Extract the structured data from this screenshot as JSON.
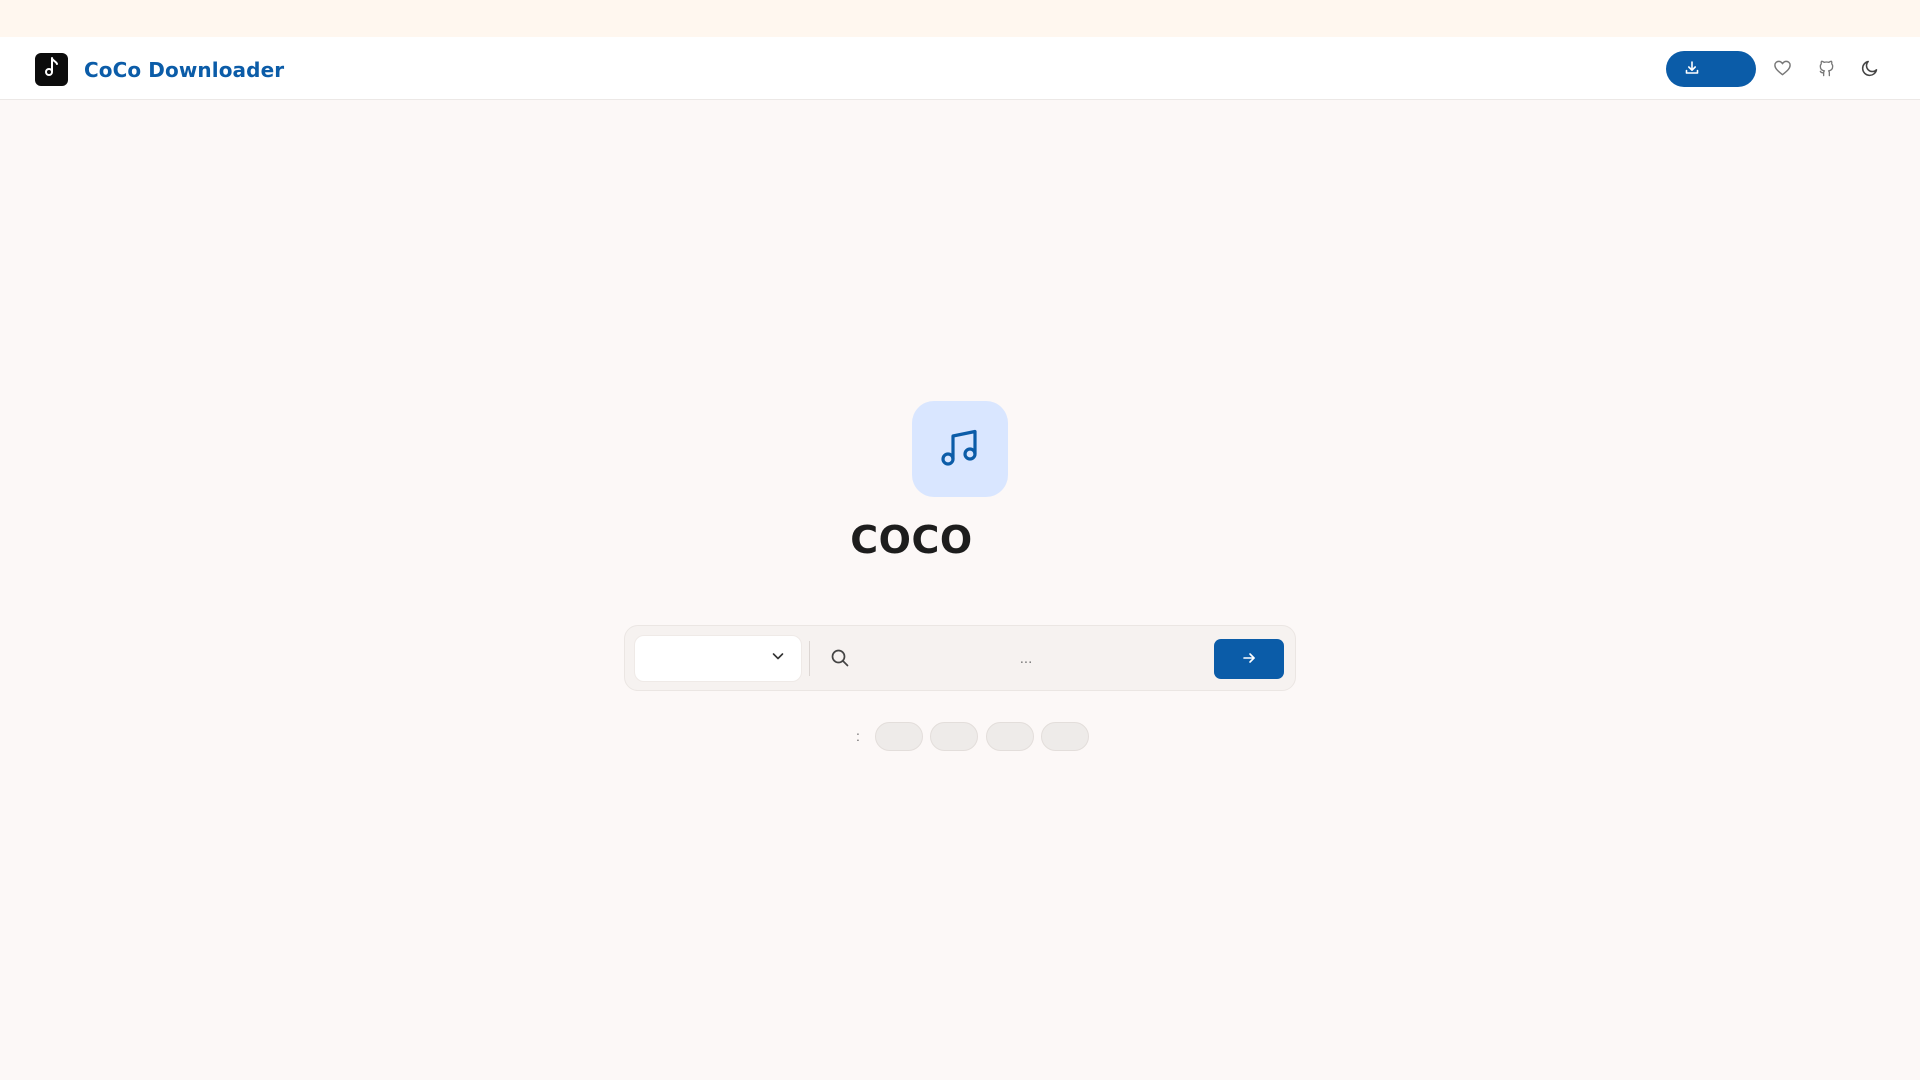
{
  "app": {
    "brand": "CoCo Downloader",
    "title": "COCO"
  },
  "header": {
    "download_label": "",
    "icons": [
      "music-note-icon",
      "download-icon",
      "heart-icon",
      "github-icon",
      "moon-icon"
    ]
  },
  "search": {
    "source_value": "",
    "placeholder": "...",
    "query": ""
  },
  "suggestions": {
    "label": ":",
    "chips": [
      "",
      "",
      "",
      ""
    ]
  },
  "colors": {
    "brand": "#0b5ca8",
    "hero_bg": "#d9e6ff",
    "page_bg": "#fcf8f7",
    "top_strip": "#fff7ef"
  }
}
